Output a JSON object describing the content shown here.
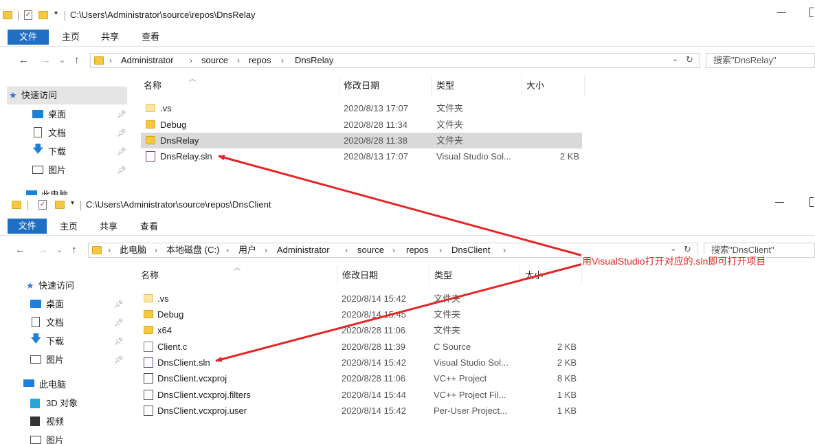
{
  "annotation": {
    "text": "用VisualStudio打开对应的.sln即可打开项目",
    "color": "#e32626"
  },
  "ribbon": {
    "file": "文件",
    "home": "主页",
    "share": "共享",
    "view": "查看"
  },
  "window_top": {
    "title": "C:\\Users\\Administrator\\source\\repos\\DnsRelay",
    "breadcrumb": [
      "Administrator",
      "source",
      "repos",
      "DnsRelay"
    ],
    "search_placeholder": "搜索\"DnsRelay\"",
    "columns": {
      "name": "名称",
      "date": "修改日期",
      "type": "类型",
      "size": "大小"
    },
    "sidebar": [
      {
        "label": "快速访问",
        "icon": "star-icon"
      },
      {
        "label": "桌面",
        "icon": "desktop-icon",
        "pinned": true
      },
      {
        "label": "文档",
        "icon": "document-icon",
        "pinned": true
      },
      {
        "label": "下载",
        "icon": "download-icon",
        "pinned": true
      },
      {
        "label": "图片",
        "icon": "picture-icon",
        "pinned": true
      },
      {
        "label": "此电脑",
        "icon": "computer-icon"
      }
    ],
    "files": [
      {
        "name": ".vs",
        "date": "2020/8/13 17:07",
        "type": "文件夹",
        "size": "",
        "icon": "folder-icon"
      },
      {
        "name": "Debug",
        "date": "2020/8/28 11:34",
        "type": "文件夹",
        "size": "",
        "icon": "folder-icon"
      },
      {
        "name": "DnsRelay",
        "date": "2020/8/28 11:38",
        "type": "文件夹",
        "size": "",
        "icon": "folder-icon",
        "selected": true
      },
      {
        "name": "DnsRelay.sln",
        "date": "2020/8/13 17:07",
        "type": "Visual Studio Sol...",
        "size": "2 KB",
        "icon": "vs-solution-icon"
      }
    ]
  },
  "window_bottom": {
    "title": "C:\\Users\\Administrator\\source\\repos\\DnsClient",
    "breadcrumb": [
      "此电脑",
      "本地磁盘 (C:)",
      "用户",
      "Administrator",
      "source",
      "repos",
      "DnsClient"
    ],
    "search_placeholder": "搜索\"DnsClient\"",
    "columns": {
      "name": "名称",
      "date": "修改日期",
      "type": "类型",
      "size": "大小"
    },
    "sidebar": [
      {
        "label": "快速访问",
        "icon": "star-icon"
      },
      {
        "label": "桌面",
        "icon": "desktop-icon",
        "pinned": true
      },
      {
        "label": "文档",
        "icon": "document-icon",
        "pinned": true
      },
      {
        "label": "下载",
        "icon": "download-icon",
        "pinned": true
      },
      {
        "label": "图片",
        "icon": "picture-icon",
        "pinned": true
      },
      {
        "label": "此电脑",
        "icon": "computer-icon"
      },
      {
        "label": "3D 对象",
        "icon": "3d-objects-icon"
      },
      {
        "label": "视频",
        "icon": "video-icon"
      },
      {
        "label": "图片",
        "icon": "picture-icon"
      }
    ],
    "files": [
      {
        "name": ".vs",
        "date": "2020/8/14 15:42",
        "type": "文件夹",
        "size": "",
        "icon": "folder-icon"
      },
      {
        "name": "Debug",
        "date": "2020/8/14 15:45",
        "type": "文件夹",
        "size": "",
        "icon": "folder-icon"
      },
      {
        "name": "x64",
        "date": "2020/8/28 11:06",
        "type": "文件夹",
        "size": "",
        "icon": "folder-icon"
      },
      {
        "name": "Client.c",
        "date": "2020/8/28 11:39",
        "type": "C Source",
        "size": "2 KB",
        "icon": "c-source-icon"
      },
      {
        "name": "DnsClient.sln",
        "date": "2020/8/14 15:42",
        "type": "Visual Studio Sol...",
        "size": "2 KB",
        "icon": "vs-solution-icon"
      },
      {
        "name": "DnsClient.vcxproj",
        "date": "2020/8/28 11:06",
        "type": "VC++ Project",
        "size": "8 KB",
        "icon": "vcxproj-icon"
      },
      {
        "name": "DnsClient.vcxproj.filters",
        "date": "2020/8/14 15:44",
        "type": "VC++ Project Fil...",
        "size": "1 KB",
        "icon": "filters-icon"
      },
      {
        "name": "DnsClient.vcxproj.user",
        "date": "2020/8/14 15:42",
        "type": "Per-User Project...",
        "size": "1 KB",
        "icon": "user-file-icon"
      }
    ]
  }
}
